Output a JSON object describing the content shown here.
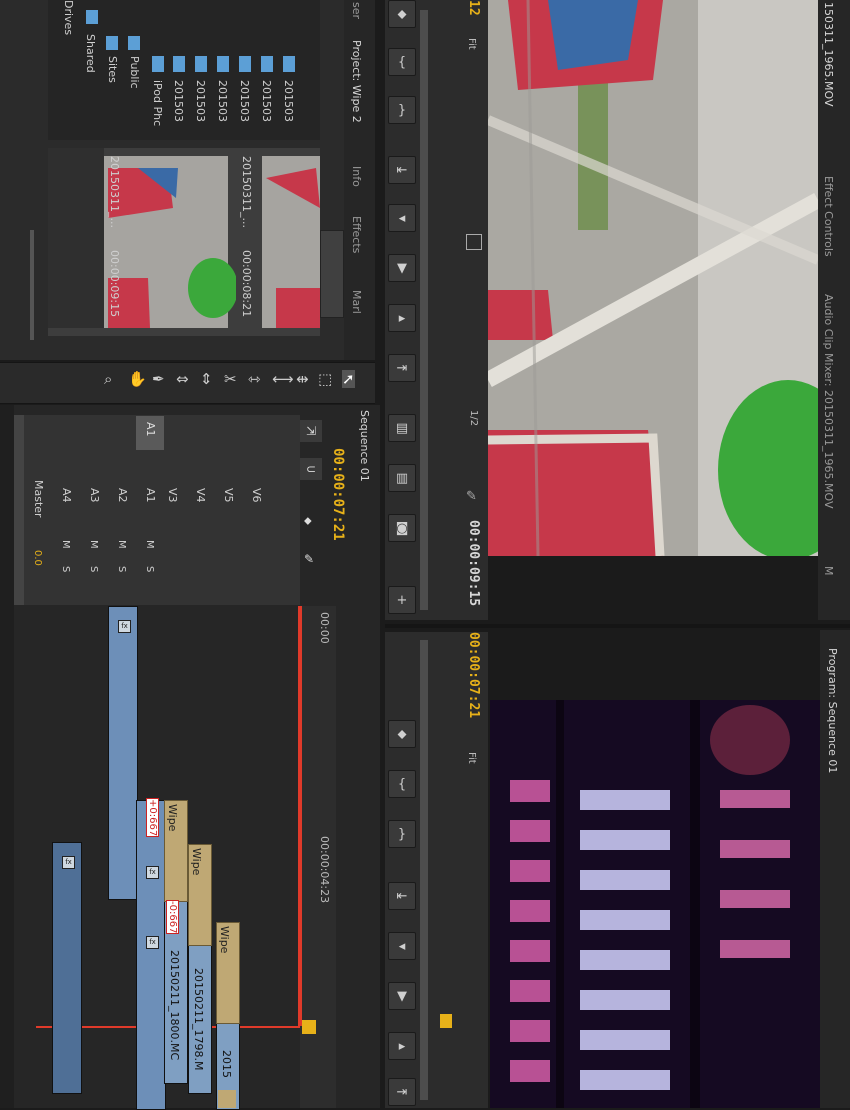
{
  "source": {
    "title": "150311_1965.MOV",
    "tabs": [
      "Effect Controls",
      "Audio Clip Mixer: 20150311_1965.MOV",
      "M"
    ],
    "timecode_left": "12",
    "fit": "Fit",
    "resolution": "1/2",
    "duration": "00:00:09:15"
  },
  "program": {
    "title": "Program: Sequence 01",
    "timecode": "00:00:07:21",
    "fit": "Fit"
  },
  "project": {
    "tabs": [
      "ser",
      "Project: Wipe 2",
      "Info",
      "Effects",
      "Marl"
    ],
    "tree": [
      {
        "label": "Drives"
      },
      {
        "label": "Shared"
      },
      {
        "label": "Sites"
      },
      {
        "label": "Public"
      },
      {
        "label": "iPod Phc"
      },
      {
        "label": "201503"
      },
      {
        "label": "201503"
      },
      {
        "label": "201503"
      },
      {
        "label": "201503"
      },
      {
        "label": "201503"
      },
      {
        "label": "201503"
      }
    ],
    "thumbs": [
      {
        "name": "20150311_...",
        "duration": "00:00:09:15"
      },
      {
        "name": "20150311_...",
        "duration": "00:00:08:21"
      }
    ]
  },
  "timeline": {
    "title": "Sequence 01",
    "timecode": "00:00:07:21",
    "ruler": [
      "00:00",
      "00:00:04:23"
    ],
    "tracks": [
      "V6",
      "V5",
      "V4",
      "V3",
      "A1",
      "A2",
      "A3",
      "A4",
      "Master"
    ],
    "master_value": "0.0",
    "clip_v3": "20150211_1800.MC",
    "clip_v4": "20150211_1798.M",
    "clip_v5": "2015",
    "wipe": "Wipe",
    "offset1": "+0:667",
    "offset2": "-0:667",
    "a1": "A1",
    "m": "M",
    "s": "S"
  },
  "colors": {
    "accent": "#e7b119",
    "audio_clip": "#6d8fb8",
    "video_clip": "#7f9fc2",
    "playhead": "#e03a2a"
  }
}
